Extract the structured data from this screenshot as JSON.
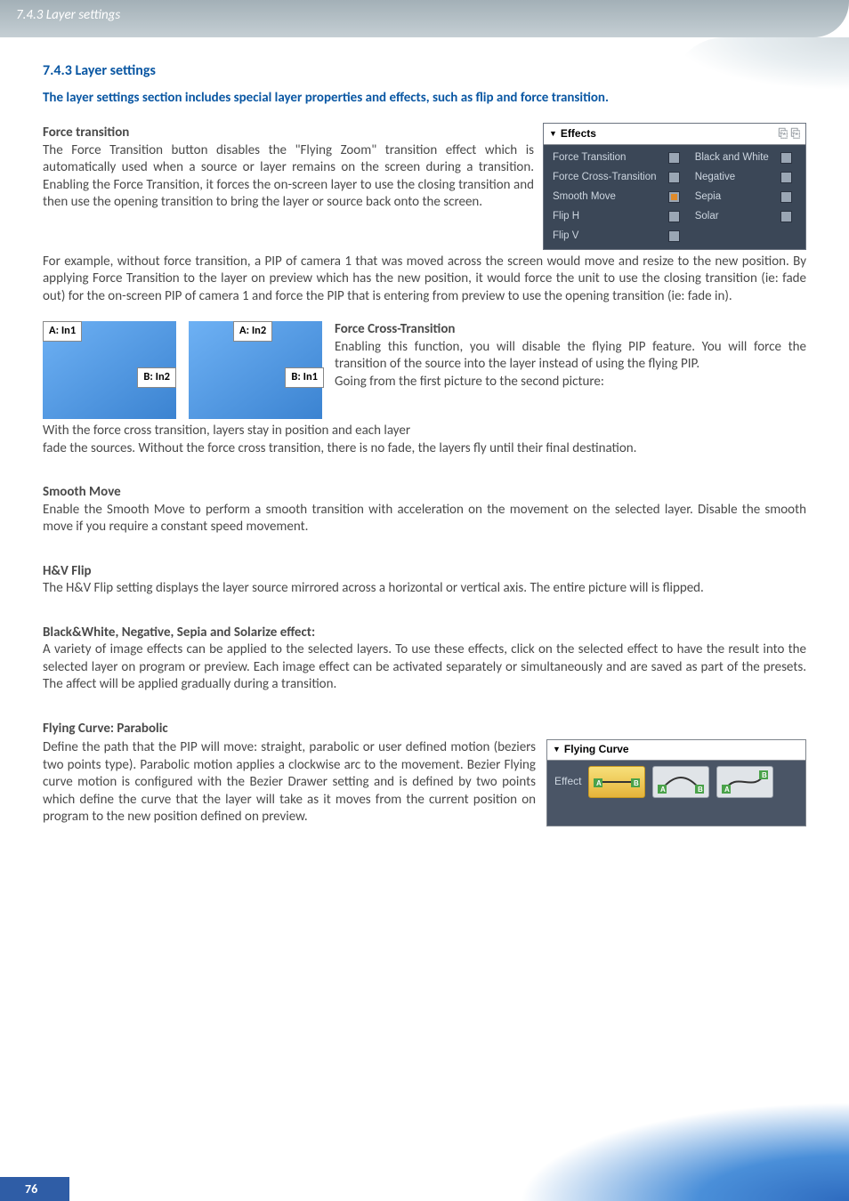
{
  "header": {
    "breadcrumb": "7.4.3 Layer settings"
  },
  "page_number": "76",
  "section": {
    "heading": "7.4.3 Layer settings",
    "intro": "The layer settings section includes special layer properties and effects, such as flip and force transition."
  },
  "effects_panel": {
    "title": "Effects",
    "rows": [
      [
        "Force Transition",
        "Black and White"
      ],
      [
        "Force Cross-Transition",
        "Negative"
      ],
      [
        "Smooth Move",
        "Sepia"
      ],
      [
        "Flip H",
        "Solar"
      ],
      [
        "Flip V",
        ""
      ]
    ]
  },
  "pip": {
    "a1": "A: In1",
    "b1": "B: In2",
    "a2": "A: In2",
    "b2": "B: In1"
  },
  "force_transition": {
    "heading": "Force transition",
    "p1": "The Force Transition button disables the \"Flying Zoom\" transition effect which is automatically used when a source or layer remains on the screen during a transition.  Enabling the Force Transition, it forces the on-screen layer to use the closing transition and then use the opening transition to bring the layer or source back onto the screen.",
    "p2": "For example, without force transition, a PIP of camera 1 that was moved across the screen would move and resize to the new position.  By applying Force Transition to the layer on preview which has the new position, it would force the unit to use the closing transition (ie: fade out) for the on-screen PIP of camera 1 and force the PIP that is entering from preview to use the opening transition (ie: fade in)."
  },
  "force_cross": {
    "heading": "Force Cross-Transition",
    "p1": "Enabling this function, you will disable the flying PIP feature. You will force the transition of the source into the layer instead of using the flying PIP.",
    "p2": "Going from the first picture to the second picture:",
    "p3": "With the force cross transition, layers stay in position and each layer",
    "p4": "fade the sources. Without the force cross transition, there is no fade, the layers fly until their final destination."
  },
  "smooth_move": {
    "heading": "Smooth Move",
    "p1": "Enable the Smooth Move to perform a smooth transition with acceleration on the movement on the selected layer. Disable the smooth move if you require a constant speed movement."
  },
  "hv_flip": {
    "heading": "H&V Flip",
    "p1": "The H&V Flip setting displays the layer source mirrored across a horizontal or vertical axis. The entire picture will is flipped."
  },
  "bw_effect": {
    "heading": "Black&White, Negative, Sepia and Solarize effect:",
    "p1": "A variety of image effects can be applied to the selected layers. To use these effects, click on the selected effect to have the result into the selected layer on program or preview. Each image effect can be activated separately or simultaneously and are saved as part of the presets.  The affect will be applied gradually during a transition."
  },
  "flying_curve": {
    "heading": "Flying Curve: Parabolic",
    "p1": "Define the path that the PIP will move: straight, parabolic or user defined motion (beziers two points type).  Parabolic motion applies a clockwise arc to the movement.  Bezier Flying curve motion is configured with the Bezier Drawer setting and is defined by two points which define the curve that the layer will take as it moves from the current position on program to the new position defined on preview."
  },
  "fly_panel": {
    "title": "Flying Curve",
    "label": "Effect",
    "tags": {
      "a": "A",
      "b": "B"
    }
  }
}
